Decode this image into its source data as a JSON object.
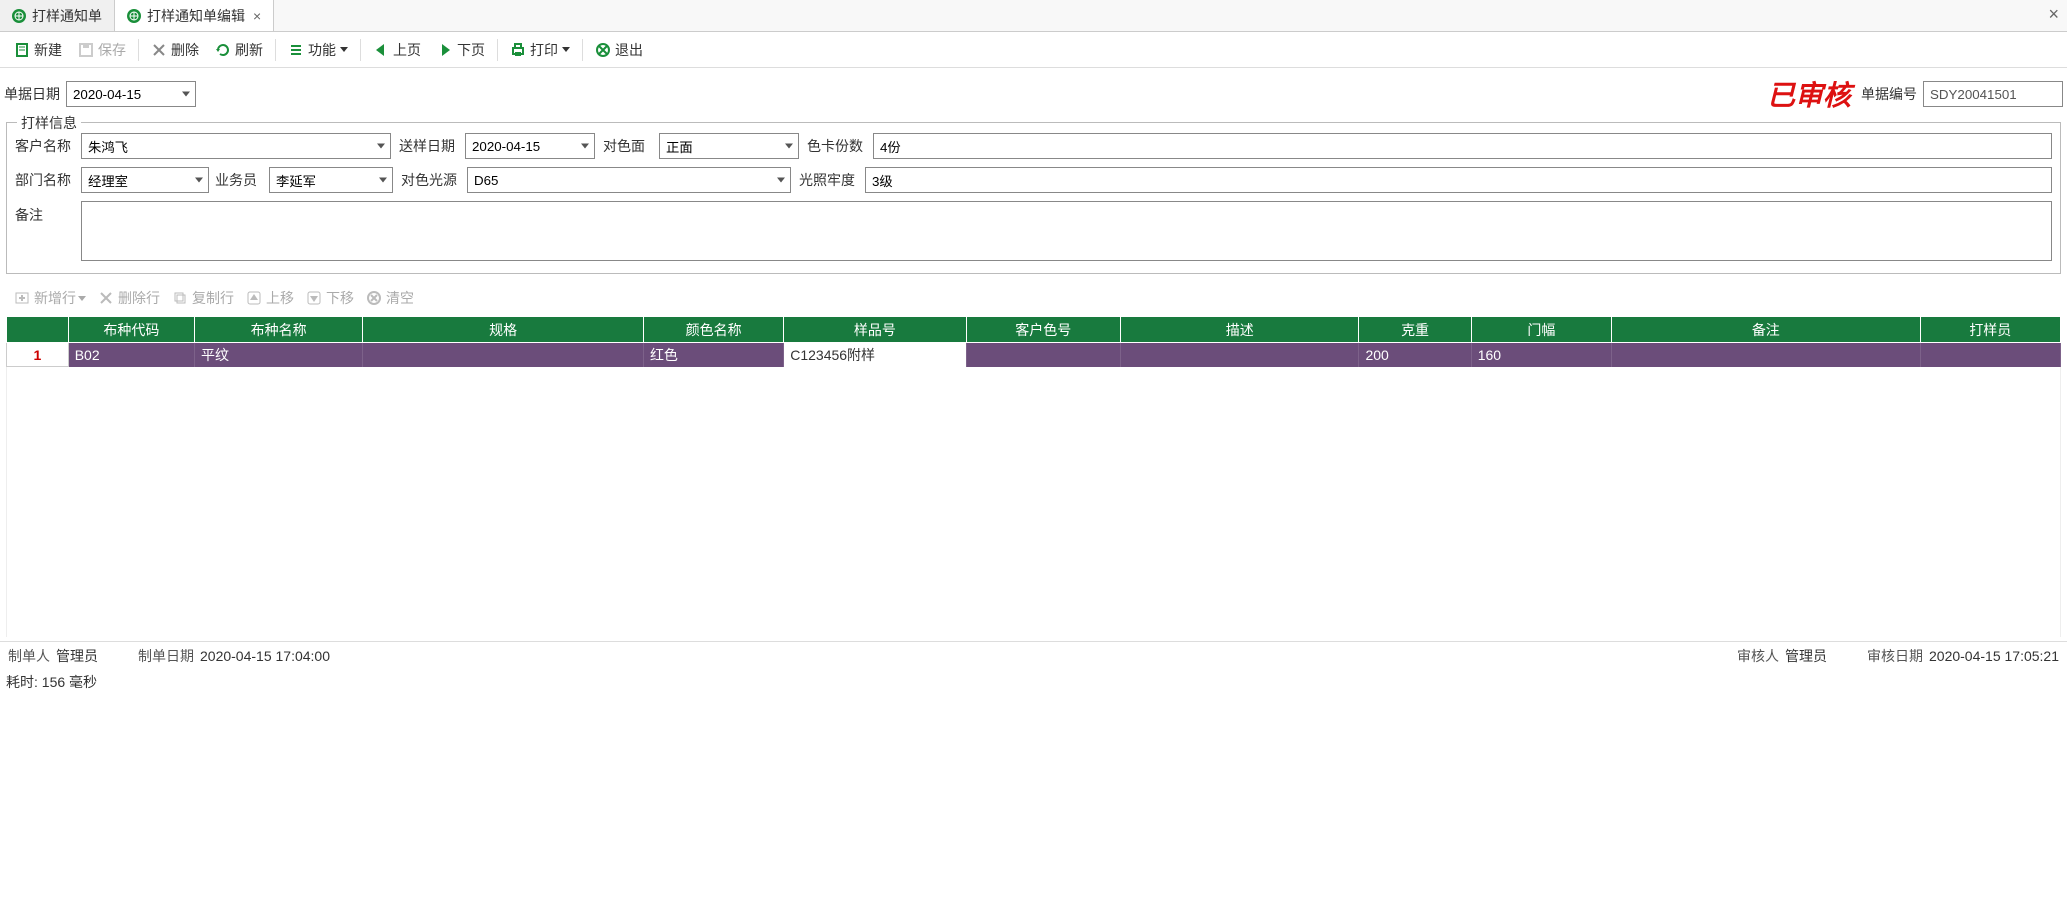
{
  "tabs": [
    {
      "label": "打样通知单",
      "active": false
    },
    {
      "label": "打样通知单编辑",
      "active": true
    }
  ],
  "toolbar": {
    "new": "新建",
    "save": "保存",
    "delete": "删除",
    "refresh": "刷新",
    "function": "功能",
    "prev": "上页",
    "next": "下页",
    "print": "打印",
    "exit": "退出"
  },
  "header": {
    "date_label": "单据日期",
    "date_value": "2020-04-15",
    "approved_stamp": "已审核",
    "doc_no_label": "单据编号",
    "doc_no_value": "SDY20041501"
  },
  "info": {
    "legend": "打样信息",
    "customer_label": "客户名称",
    "customer_value": "朱鸿飞",
    "send_date_label": "送样日期",
    "send_date_value": "2020-04-15",
    "match_face_label": "对色面",
    "match_face_value": "正面",
    "card_count_label": "色卡份数",
    "card_count_value": "4份",
    "dept_label": "部门名称",
    "dept_value": "经理室",
    "salesman_label": "业务员",
    "salesman_value": "李延军",
    "light_source_label": "对色光源",
    "light_source_value": "D65",
    "light_fastness_label": "光照牢度",
    "light_fastness_value": "3级",
    "remark_label": "备注",
    "remark_value": ""
  },
  "grid_toolbar": {
    "add_row": "新增行",
    "delete_row": "删除行",
    "copy_row": "复制行",
    "move_up": "上移",
    "move_down": "下移",
    "clear": "清空"
  },
  "grid": {
    "headers": {
      "code": "布种代码",
      "name": "布种名称",
      "spec": "规格",
      "color": "颜色名称",
      "sample_no": "样品号",
      "cust_color": "客户色号",
      "desc": "描述",
      "weight": "克重",
      "width": "门幅",
      "remark": "备注",
      "sampler": "打样员"
    },
    "rows": [
      {
        "num": "1",
        "code": "B02",
        "name": "平纹",
        "spec": "",
        "color": "红色",
        "sample_no": "C123456附样",
        "cust_color": "",
        "desc": "",
        "weight": "200",
        "width": "160",
        "remark": "",
        "sampler": ""
      }
    ]
  },
  "footer": {
    "creator_label": "制单人",
    "creator_value": "管理员",
    "create_date_label": "制单日期",
    "create_date_value": "2020-04-15 17:04:00",
    "auditor_label": "审核人",
    "auditor_value": "管理员",
    "audit_date_label": "审核日期",
    "audit_date_value": "2020-04-15 17:05:21",
    "timing": "耗时: 156 毫秒"
  }
}
